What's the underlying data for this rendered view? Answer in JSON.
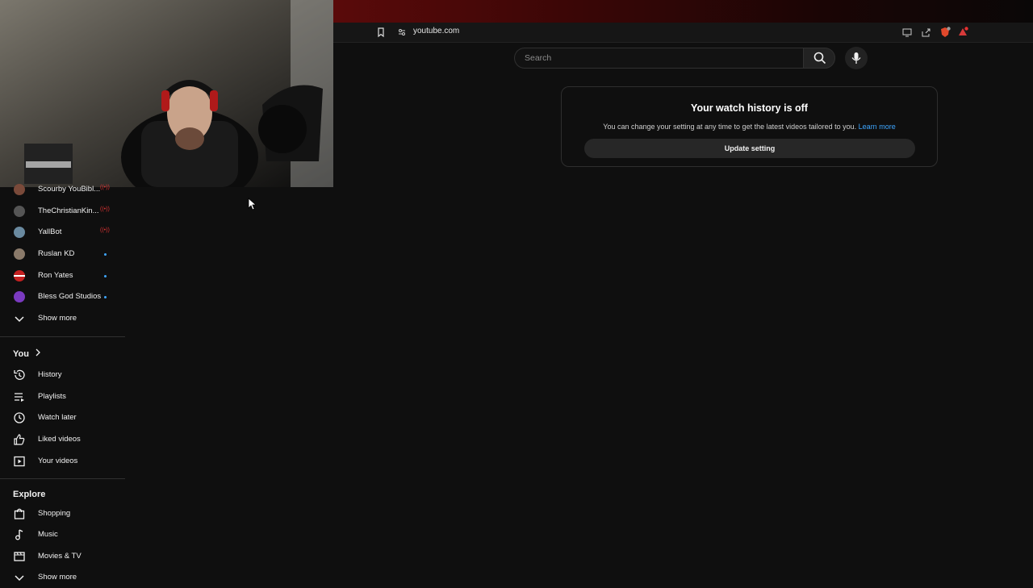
{
  "browser": {
    "url": "youtube.com",
    "notification_count": "1"
  },
  "search": {
    "placeholder": "Search"
  },
  "card": {
    "title": "Your watch history is off",
    "message": "You can change your setting at any time to get the latest videos tailored to you.",
    "learn_more": "Learn more",
    "button": "Update setting"
  },
  "sidebar": {
    "subscriptions": [
      {
        "label": "Scourby YouBibl...",
        "status": "live",
        "avatar_color": "#7a4a3a"
      },
      {
        "label": "TheChristianKin...",
        "status": "live",
        "avatar_color": "#555555"
      },
      {
        "label": "YallBot",
        "status": "live",
        "avatar_color": "#6a8aa0"
      },
      {
        "label": "Ruslan KD",
        "status": "new",
        "avatar_color": "#8a7a6a"
      },
      {
        "label": "Ron Yates",
        "status": "new",
        "avatar_color": "#c42020"
      },
      {
        "label": "Bless God Studios",
        "status": "new",
        "avatar_color": "#7a3ac0"
      }
    ],
    "show_more_1": "Show more",
    "you_heading": "You",
    "you_items": [
      "History",
      "Playlists",
      "Watch later",
      "Liked videos",
      "Your videos"
    ],
    "explore_heading": "Explore",
    "explore_items": [
      "Shopping",
      "Music",
      "Movies & TV"
    ],
    "show_more_2": "Show more"
  },
  "colors": {
    "background": "#0f0f0f",
    "live": "#dd3333",
    "link": "#3ea6ff",
    "tab_accent": "#5a0a0a"
  }
}
